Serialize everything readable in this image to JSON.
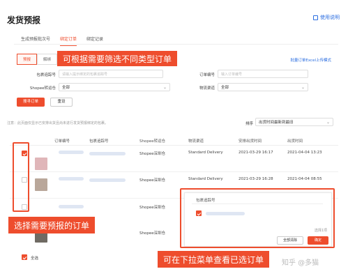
{
  "page": {
    "title": "发货预报",
    "help_link": "使用说明"
  },
  "tabs": [
    {
      "label": "生成预报批次号"
    },
    {
      "label": "绑定订单"
    },
    {
      "label": "绑定记录"
    }
  ],
  "subtabs": [
    {
      "label": "预报"
    },
    {
      "label": "解绑"
    }
  ],
  "upload_link": "批量订单Excel上传模式",
  "filters": {
    "package_tracking_label": "包裹追踪号",
    "package_tracking_placeholder": "请输入提示绑定的包裹追踪号",
    "order_number_label": "订单编号",
    "order_number_placeholder": "输入订单编号",
    "warehouse_label": "Shopee转运仓",
    "warehouse_value": "全部",
    "channel_label": "物流渠道",
    "channel_value": "全部"
  },
  "buttons": {
    "search": "搜寻订单",
    "reset": "重设"
  },
  "note": "注意：此页面仅显示已安排出货且尚未进行发货预报绑定的包裹。",
  "sort": {
    "label": "排序",
    "value": "出货时间最新到最旧"
  },
  "table": {
    "headers": [
      "订单编号",
      "包裹追踪号",
      "Shopee转运仓",
      "物流渠道",
      "安排出货时间",
      "出货时间"
    ],
    "rows": [
      {
        "warehouse": "Shopee深圳仓",
        "channel": "Standard Delivery",
        "arrange_time": "2021-03-29 16:17",
        "ship_time": "2021-04-04 13:23",
        "checked": true
      },
      {
        "warehouse": "Shopee深圳仓",
        "channel": "Standard Delivery",
        "arrange_time": "2021-03-29 16:28",
        "ship_time": "2021-04-04 08:55",
        "checked": false
      },
      {
        "warehouse": "Shopee深圳仓",
        "channel": "",
        "arrange_time": "",
        "ship_time": "",
        "checked": false
      },
      {
        "warehouse": "Shopee深圳仓",
        "channel": "",
        "arrange_time": "",
        "ship_time": "",
        "checked": false
      }
    ]
  },
  "dropdown": {
    "header": "包裹追踪号",
    "selected_count": "选择1项",
    "clear_all": "全部清除",
    "confirm": "确定"
  },
  "footer": {
    "select_all": "全选"
  },
  "callouts": {
    "filter": "可根据需要筛选不同类型订单",
    "select": "选择需要预报的订单",
    "dropdown": "可在下拉菜单查看已选订单"
  },
  "watermark": "知乎 @多猫",
  "colors": {
    "accent": "#ee4d2d",
    "link": "#2a6de0"
  }
}
